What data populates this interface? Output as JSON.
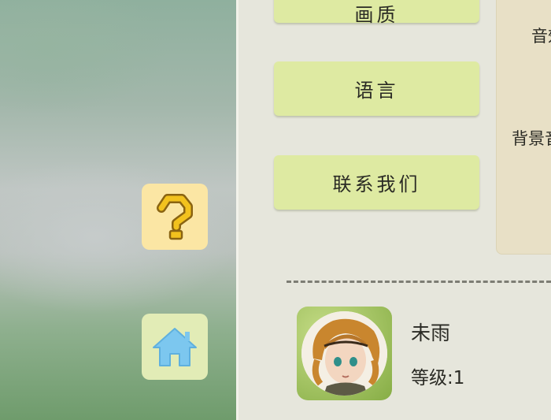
{
  "sidebar": {
    "help_icon": "question-mark-icon",
    "home_icon": "home-icon",
    "help_color": "#f2c21e",
    "home_color": "#7cc7ef"
  },
  "menu": {
    "top_partial_label": "画质",
    "language_label": "语言",
    "contact_label": "联系我们"
  },
  "audio": {
    "sound_label": "音效",
    "bgm_label": "背景音乐"
  },
  "player": {
    "name": "未雨",
    "level": "等级:1"
  }
}
